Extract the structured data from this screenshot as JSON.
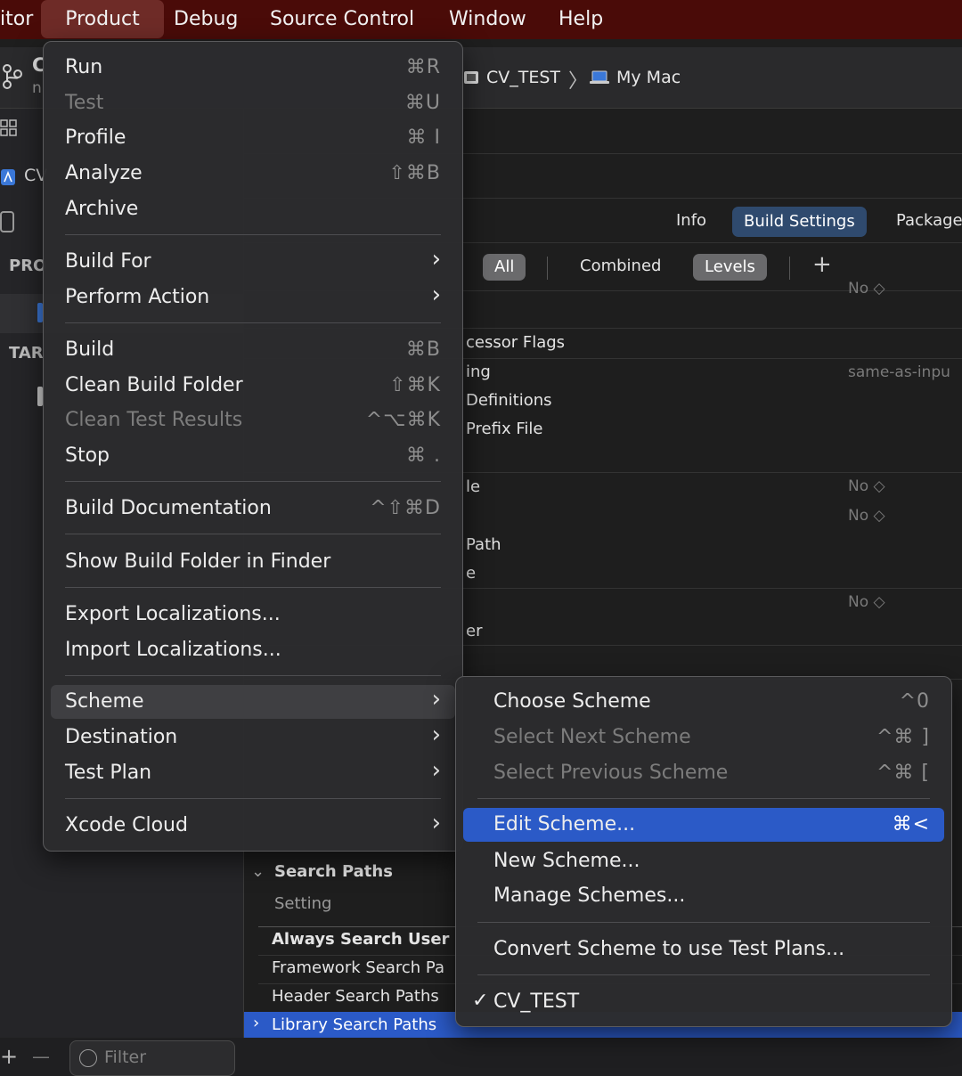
{
  "menubar": {
    "items": [
      "itor",
      "Product",
      "Debug",
      "Source Control",
      "Window",
      "Help"
    ]
  },
  "toolbar": {
    "scheme": "CV_TEST",
    "destination": "My Mac",
    "partial_title": "C",
    "partial_subtitle": "n"
  },
  "editor": {
    "tabs": [
      "Info",
      "Build Settings",
      "Package"
    ],
    "filters": [
      "All",
      "Combined",
      "Levels"
    ],
    "add_symbol": "+",
    "rows": [
      {
        "label": "cessor Flags",
        "value": ""
      },
      {
        "label": "ing",
        "value": "same-as-inpu"
      },
      {
        "label": "Definitions",
        "value": ""
      },
      {
        "label": "Prefix File",
        "value": ""
      },
      {
        "label": "le",
        "value": "No ◇"
      },
      {
        "label": "",
        "value": "No ◇"
      },
      {
        "label": "Path",
        "value": ""
      },
      {
        "label": "e",
        "value": ""
      },
      {
        "label": "",
        "value": "No ◇"
      },
      {
        "label": "er",
        "value": ""
      }
    ],
    "top_value": "No ◇",
    "search_paths": {
      "section": "Search Paths",
      "col_header": "Setting",
      "rows": [
        "Always Search User",
        "Framework Search Pa",
        "Header Search Paths",
        "Library Search Paths"
      ]
    }
  },
  "sidebar": {
    "partial_cv": "CV",
    "project_header": "PRO",
    "targets_header": "TAR",
    "filter_placeholder": "Filter",
    "add": "+",
    "remove": "—"
  },
  "product_menu": {
    "items": [
      {
        "label": "Run",
        "shortcut": "⌘R"
      },
      {
        "label": "Test",
        "shortcut": "⌘U"
      },
      {
        "label": "Profile",
        "shortcut": "⌘ I"
      },
      {
        "label": "Analyze",
        "shortcut": "⇧⌘B"
      },
      {
        "label": "Archive",
        "shortcut": ""
      },
      {
        "label": "Build For",
        "shortcut": ""
      },
      {
        "label": "Perform Action",
        "shortcut": ""
      },
      {
        "label": "Build",
        "shortcut": "⌘B"
      },
      {
        "label": "Clean Build Folder",
        "shortcut": "⇧⌘K"
      },
      {
        "label": "Clean Test Results",
        "shortcut": "^⌥⌘K"
      },
      {
        "label": "Stop",
        "shortcut": "⌘ ."
      },
      {
        "label": "Build Documentation",
        "shortcut": "^⇧⌘D"
      },
      {
        "label": "Show Build Folder in Finder",
        "shortcut": ""
      },
      {
        "label": "Export Localizations...",
        "shortcut": ""
      },
      {
        "label": "Import Localizations...",
        "shortcut": ""
      },
      {
        "label": "Scheme",
        "shortcut": ""
      },
      {
        "label": "Destination",
        "shortcut": ""
      },
      {
        "label": "Test Plan",
        "shortcut": ""
      },
      {
        "label": "Xcode Cloud",
        "shortcut": ""
      }
    ]
  },
  "scheme_menu": {
    "items": [
      {
        "label": "Choose Scheme",
        "shortcut": "^0"
      },
      {
        "label": "Select Next Scheme",
        "shortcut": "^⌘ ]"
      },
      {
        "label": "Select Previous Scheme",
        "shortcut": "^⌘ ["
      },
      {
        "label": "Edit Scheme...",
        "shortcut": "⌘<"
      },
      {
        "label": "New Scheme...",
        "shortcut": ""
      },
      {
        "label": "Manage Schemes...",
        "shortcut": ""
      },
      {
        "label": "Convert Scheme to use Test Plans...",
        "shortcut": ""
      },
      {
        "label": "CV_TEST",
        "shortcut": ""
      }
    ],
    "check": "✓"
  },
  "colors": {
    "menubar": "#4a0b08",
    "selection": "#2b5ac7",
    "tab_active": "#2f4a6e"
  }
}
